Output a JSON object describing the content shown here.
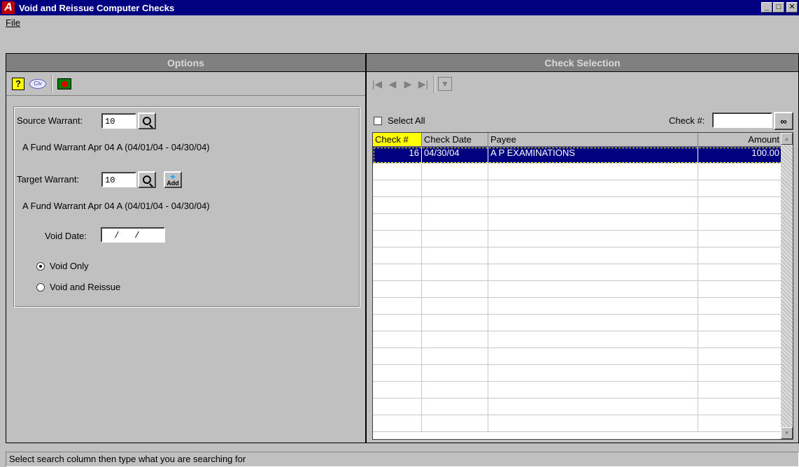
{
  "window": {
    "title": "Void and Reissue Computer Checks",
    "controls": {
      "minimize": "_",
      "maximize": "□",
      "close": "✕"
    }
  },
  "menu": {
    "file": "File"
  },
  "options_panel": {
    "header": "Options",
    "toolbar": {
      "help_icon": "?",
      "logo_icon": "Civ"
    },
    "source_warrant": {
      "label": "Source Warrant:",
      "value": "10",
      "description": "A Fund Warrant Apr 04   A   (04/01/04 - 04/30/04)"
    },
    "target_warrant": {
      "label": "Target Warrant:",
      "value": "10",
      "add_label": "Add",
      "description": "A Fund Warrant Apr 04   A   (04/01/04 - 04/30/04)"
    },
    "void_date": {
      "label": "Void Date:",
      "value": "  /   /"
    },
    "radio": {
      "void_only": "Void Only",
      "void_reissue": "Void and Reissue"
    }
  },
  "check_panel": {
    "header": "Check Selection",
    "nav": {
      "first": "|◀",
      "prev": "◀",
      "next": "▶",
      "last": "▶|"
    },
    "select_all_label": "Select All",
    "check_num_label": "Check #:",
    "check_num_value": "",
    "grid": {
      "columns": [
        "Check #",
        "Check Date",
        "Payee",
        "Amount"
      ],
      "rows": [
        {
          "check_no": "16",
          "date": "04/30/04",
          "payee": "A P EXAMINATIONS",
          "amount": "100.00"
        }
      ]
    }
  },
  "status": "Select search column then type what you are searching for"
}
